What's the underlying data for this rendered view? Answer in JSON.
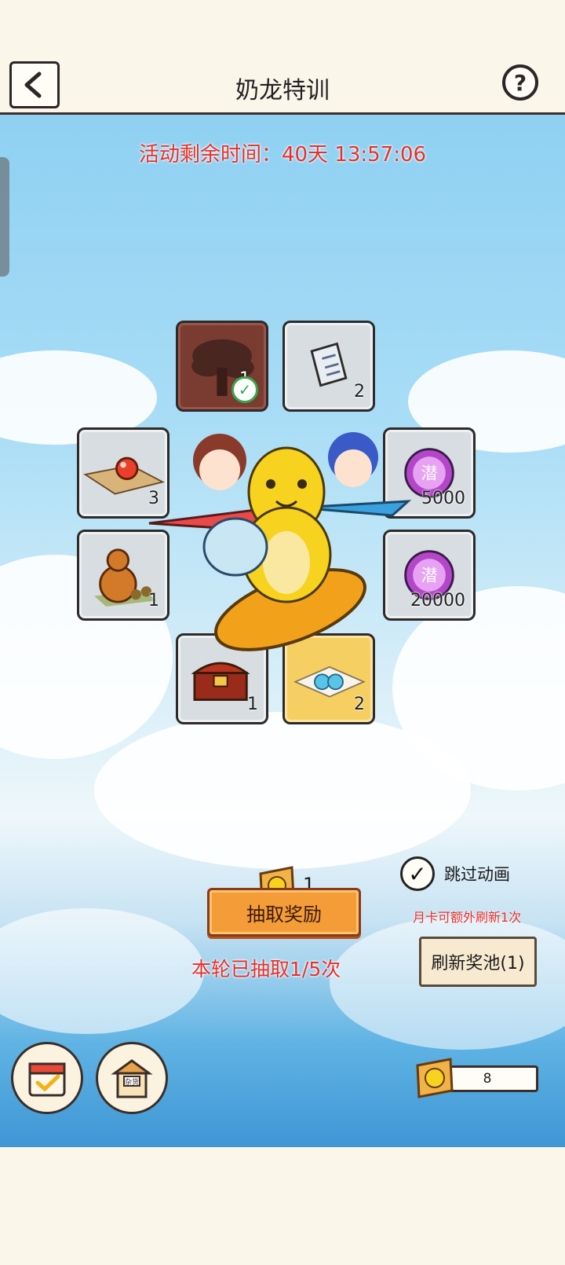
{
  "header": {
    "title": "奶龙特训",
    "back_icon": "back-chevron-icon",
    "help_icon": "question-mark-icon",
    "help_text": "?"
  },
  "event": {
    "timer_text": "活动剩余时间：40天 13:57:06"
  },
  "prize_pool": [
    {
      "name": "tree-item",
      "count": "1",
      "claimed": true
    },
    {
      "name": "scroll-item",
      "count": "2",
      "claimed": false
    },
    {
      "name": "orb-on-map-item",
      "count": "3",
      "claimed": false
    },
    {
      "name": "potential-orb-item",
      "count": "5000",
      "claimed": false
    },
    {
      "name": "gourd-item",
      "count": "1",
      "claimed": false
    },
    {
      "name": "potential-orb-item",
      "count": "20000",
      "claimed": false
    },
    {
      "name": "treasure-chest-item",
      "count": "1",
      "claimed": false
    },
    {
      "name": "letter-pearls-item",
      "count": "2",
      "claimed": false
    }
  ],
  "controls": {
    "ticket_count": "1",
    "skip_animation_label": "跳过动画",
    "skip_checked": true,
    "draw_button_label": "抽取奖励",
    "monthly_card_note": "月卡可额外刷新1次",
    "round_progress": "本轮已抽取1/5次",
    "refresh_button_label": "刷新奖池(1)"
  },
  "bottom": {
    "calendar_icon": "calendar-check-icon",
    "shop_icon": "shop-icon",
    "shop_sign": "杂货",
    "ticket_balance": "8"
  },
  "colors": {
    "accent_red": "#e8302a",
    "button_orange": "#f49c38",
    "sky_blue": "#8fd0f2"
  }
}
